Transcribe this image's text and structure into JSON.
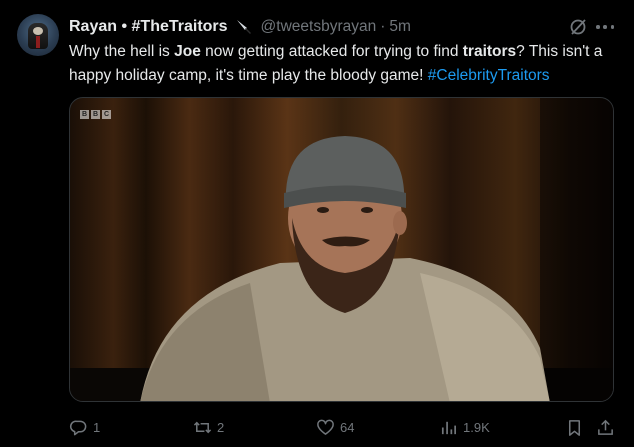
{
  "tweet": {
    "display_name": "Rayan • #TheTraitors",
    "handle": "@tweetsbyrayan",
    "separator": "·",
    "time": "5m",
    "text_parts": {
      "p1": "Why the hell is ",
      "b1": "Joe",
      "p2": " now getting attacked for trying to find ",
      "b2": "traitors",
      "p3": "? This isn't a happy holiday camp, it's time play the bloody game! ",
      "hashtag": "#CelebrityTraitors"
    }
  },
  "media": {
    "watermark": [
      "B",
      "B",
      "C"
    ]
  },
  "actions": {
    "replies": "1",
    "reposts": "2",
    "likes": "64",
    "views": "1.9K"
  },
  "icons": {
    "knife": "knife-emoji",
    "grok": "grok-icon",
    "more": "more-icon",
    "reply": "reply-icon",
    "repost": "repost-icon",
    "like": "heart-icon",
    "views": "views-icon",
    "bookmark": "bookmark-icon",
    "share": "share-icon"
  },
  "colors": {
    "background": "#000000",
    "text": "#e7e9ea",
    "muted": "#71767b",
    "link": "#1d9bf0"
  }
}
